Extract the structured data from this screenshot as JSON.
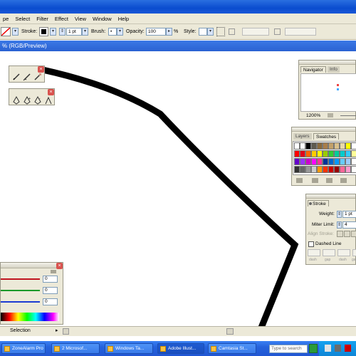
{
  "menu": [
    "pe",
    "Select",
    "Filter",
    "Effect",
    "View",
    "Window",
    "Help"
  ],
  "control_bar": {
    "stroke_label": "Stroke:",
    "stroke_weight": "1 pt",
    "brush_label": "Brush:",
    "brush_value": "•",
    "opacity_label": "Opacity:",
    "opacity_value": "100",
    "opacity_unit": "%",
    "style_label": "Style:"
  },
  "document_tab": "% (RGB/Preview)",
  "navigator": {
    "tabs": [
      "Navigator",
      "Info"
    ],
    "zoom": "1200%"
  },
  "swatches": {
    "tabs": [
      "Layers",
      "Swatches"
    ],
    "colors": [
      [
        "#ffffff",
        "#ffffff",
        "#000000",
        "#5e5a4f",
        "#8a6a3b",
        "#a87d4a",
        "#c2a06a",
        "#d9c08c",
        "#e8d8a8",
        "#ffff00",
        "#ffffff"
      ],
      [
        "#ff0000",
        "#e2001a",
        "#ff6600",
        "#ffcc00",
        "#ffff00",
        "#99cc00",
        "#33cc33",
        "#00cc99",
        "#00cccc",
        "#33ccff",
        "#ffff99"
      ],
      [
        "#6600cc",
        "#9933ff",
        "#cc00cc",
        "#ff00ff",
        "#ff3399",
        "#003399",
        "#0066cc",
        "#0099ff",
        "#66ccff",
        "#99ccff",
        "#ffffff"
      ],
      [
        "#333333",
        "#666666",
        "#999999",
        "#cccccc",
        "#ff9900",
        "#ff3300",
        "#cc0000",
        "#990000",
        "#ff6699",
        "#ff99cc",
        "#ffffff"
      ]
    ]
  },
  "stroke_panel": {
    "title": "Stroke",
    "weight_label": "Weight:",
    "weight_value": "1 pt",
    "miter_label": "Miter Limit:",
    "miter_value": "4",
    "align_label": "Align Stroke:",
    "dashed_label": "Dashed Line",
    "dash_labels": [
      "dash",
      "gap",
      "dash",
      "gap"
    ]
  },
  "color_panel": {
    "values": [
      "0",
      "0",
      "0"
    ],
    "bar_colors": [
      "#c0141e",
      "#1a9a2a",
      "#1c3bd2"
    ]
  },
  "status_bar": {
    "selection_label": "Selection"
  },
  "taskbar": {
    "tasks": [
      "ZoneAlarm Pro",
      "2 Microsof...",
      "Windows Ta...",
      "Adobe Illust...",
      "Camtasia St..."
    ],
    "search_placeholder": "Type to search"
  }
}
